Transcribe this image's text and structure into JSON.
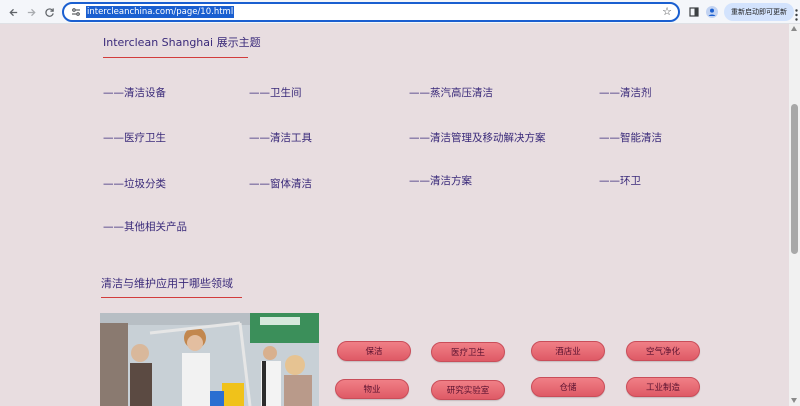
{
  "browser": {
    "url": "intercleanchina.com/page/10.html",
    "update_label": "重新启动即可更新"
  },
  "section1": {
    "title": "Interclean Shanghai 展示主题",
    "topics": [
      "——清洁设备",
      "——卫生间",
      "——蒸汽高压清洁",
      "——清洁剂",
      "——医疗卫生",
      "——清洁工具",
      "——清洁管理及移动解决方案",
      "——智能清洁",
      "——垃圾分类",
      "——窗体清洁",
      "——清洁方案",
      "——环卫",
      "——其他相关产品"
    ]
  },
  "section2": {
    "title": "清洁与维护应用于哪些领域",
    "pills": [
      "保洁",
      "医疗卫生",
      "酒店业",
      "空气净化",
      "物业",
      "研究实验室",
      "仓储",
      "工业制造"
    ]
  },
  "colors": {
    "background": "#e8dde0",
    "accent_text": "#3a2a7a",
    "underline": "#d23c3c",
    "pill": "#e86c75"
  }
}
